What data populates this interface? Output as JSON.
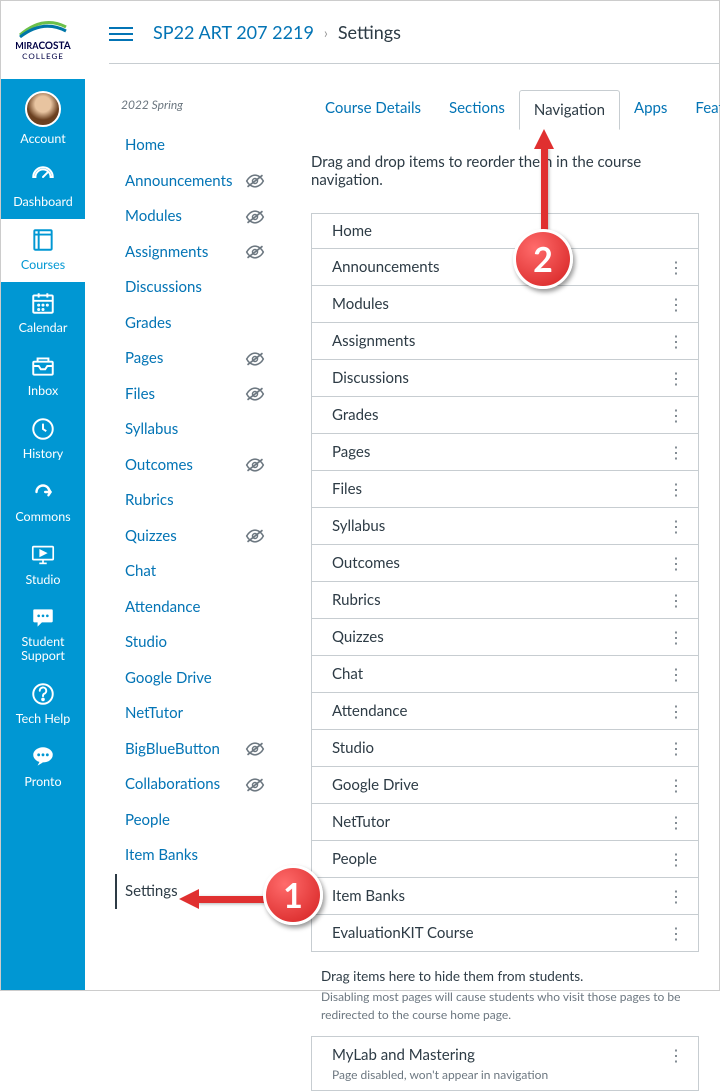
{
  "logo": {
    "name": "MiraCosta College"
  },
  "global_nav": [
    {
      "label": "Account",
      "icon": "avatar"
    },
    {
      "label": "Dashboard",
      "icon": "speedometer"
    },
    {
      "label": "Courses",
      "icon": "book",
      "active": true
    },
    {
      "label": "Calendar",
      "icon": "calendar"
    },
    {
      "label": "Inbox",
      "icon": "inbox"
    },
    {
      "label": "History",
      "icon": "clock"
    },
    {
      "label": "Commons",
      "icon": "commons"
    },
    {
      "label": "Studio",
      "icon": "studio"
    },
    {
      "label": "Student Support",
      "icon": "chat"
    },
    {
      "label": "Tech Help",
      "icon": "help"
    },
    {
      "label": "Pronto",
      "icon": "pronto"
    }
  ],
  "breadcrumb": {
    "course": "SP22 ART 207 2219",
    "page": "Settings"
  },
  "term": "2022 Spring",
  "course_nav": [
    {
      "label": "Home",
      "hidden": false
    },
    {
      "label": "Announcements",
      "hidden": true
    },
    {
      "label": "Modules",
      "hidden": true
    },
    {
      "label": "Assignments",
      "hidden": true
    },
    {
      "label": "Discussions",
      "hidden": false
    },
    {
      "label": "Grades",
      "hidden": false
    },
    {
      "label": "Pages",
      "hidden": true
    },
    {
      "label": "Files",
      "hidden": true
    },
    {
      "label": "Syllabus",
      "hidden": false
    },
    {
      "label": "Outcomes",
      "hidden": true
    },
    {
      "label": "Rubrics",
      "hidden": false
    },
    {
      "label": "Quizzes",
      "hidden": true
    },
    {
      "label": "Chat",
      "hidden": false
    },
    {
      "label": "Attendance",
      "hidden": false
    },
    {
      "label": "Studio",
      "hidden": false
    },
    {
      "label": "Google Drive",
      "hidden": false
    },
    {
      "label": "NetTutor",
      "hidden": false
    },
    {
      "label": "BigBlueButton",
      "hidden": true
    },
    {
      "label": "Collaborations",
      "hidden": true
    },
    {
      "label": "People",
      "hidden": false
    },
    {
      "label": "Item Banks",
      "hidden": false
    },
    {
      "label": "Settings",
      "hidden": false,
      "active": true
    }
  ],
  "tabs": [
    {
      "label": "Course Details"
    },
    {
      "label": "Sections"
    },
    {
      "label": "Navigation",
      "active": true
    },
    {
      "label": "Apps"
    },
    {
      "label": "Featu"
    }
  ],
  "instructions": "Drag and drop items to reorder them in the course navigation.",
  "nav_items": [
    "Home",
    "Announcements",
    "Modules",
    "Assignments",
    "Discussions",
    "Grades",
    "Pages",
    "Files",
    "Syllabus",
    "Outcomes",
    "Rubrics",
    "Quizzes",
    "Chat",
    "Attendance",
    "Studio",
    "Google Drive",
    "NetTutor",
    "People",
    "Item Banks",
    "EvaluationKIT Course"
  ],
  "hide_instructions": "Drag items here to hide them from students.",
  "hide_note": "Disabling most pages will cause students who visit those pages to be redirected to the course home page.",
  "disabled_item": {
    "label": "MyLab and Mastering",
    "sub": "Page disabled, won't appear in navigation"
  },
  "annotations": {
    "one": "1",
    "two": "2"
  }
}
